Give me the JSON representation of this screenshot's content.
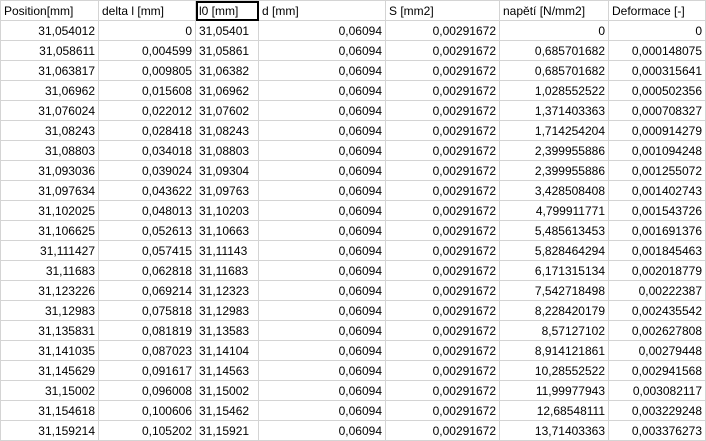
{
  "spreadsheet": {
    "headers": [
      "Position[mm]",
      "delta l [mm]",
      "l0 [mm]",
      "d [mm]",
      "S [mm2]",
      "napětí [N/mm2]",
      "Deformace [-]"
    ],
    "rows": [
      [
        "31,054012",
        "0",
        "31,05401",
        "0,06094",
        "0,00291672",
        "0",
        "0"
      ],
      [
        "31,058611",
        "0,004599",
        "31,05861",
        "0,06094",
        "0,00291672",
        "0,685701682",
        "0,000148075"
      ],
      [
        "31,063817",
        "0,009805",
        "31,06382",
        "0,06094",
        "0,00291672",
        "0,685701682",
        "0,000315641"
      ],
      [
        "31,06962",
        "0,015608",
        "31,06962",
        "0,06094",
        "0,00291672",
        "1,028552522",
        "0,000502356"
      ],
      [
        "31,076024",
        "0,022012",
        "31,07602",
        "0,06094",
        "0,00291672",
        "1,371403363",
        "0,000708327"
      ],
      [
        "31,08243",
        "0,028418",
        "31,08243",
        "0,06094",
        "0,00291672",
        "1,714254204",
        "0,000914279"
      ],
      [
        "31,08803",
        "0,034018",
        "31,08803",
        "0,06094",
        "0,00291672",
        "2,399955886",
        "0,001094248"
      ],
      [
        "31,093036",
        "0,039024",
        "31,09304",
        "0,06094",
        "0,00291672",
        "2,399955886",
        "0,001255072"
      ],
      [
        "31,097634",
        "0,043622",
        "31,09763",
        "0,06094",
        "0,00291672",
        "3,428508408",
        "0,001402743"
      ],
      [
        "31,102025",
        "0,048013",
        "31,10203",
        "0,06094",
        "0,00291672",
        "4,799911771",
        "0,001543726"
      ],
      [
        "31,106625",
        "0,052613",
        "31,10663",
        "0,06094",
        "0,00291672",
        "5,485613453",
        "0,001691376"
      ],
      [
        "31,111427",
        "0,057415",
        "31,11143",
        "0,06094",
        "0,00291672",
        "5,828464294",
        "0,001845463"
      ],
      [
        "31,11683",
        "0,062818",
        "31,11683",
        "0,06094",
        "0,00291672",
        "6,171315134",
        "0,002018779"
      ],
      [
        "31,123226",
        "0,069214",
        "31,12323",
        "0,06094",
        "0,00291672",
        "7,542718498",
        "0,00222387"
      ],
      [
        "31,12983",
        "0,075818",
        "31,12983",
        "0,06094",
        "0,00291672",
        "8,228420179",
        "0,002435542"
      ],
      [
        "31,135831",
        "0,081819",
        "31,13583",
        "0,06094",
        "0,00291672",
        "8,57127102",
        "0,002627808"
      ],
      [
        "31,141035",
        "0,087023",
        "31,14104",
        "0,06094",
        "0,00291672",
        "8,914121861",
        "0,00279448"
      ],
      [
        "31,145629",
        "0,091617",
        "31,14563",
        "0,06094",
        "0,00291672",
        "10,28552522",
        "0,002941568"
      ],
      [
        "31,15002",
        "0,096008",
        "31,15002",
        "0,06094",
        "0,00291672",
        "11,99977943",
        "0,003082117"
      ],
      [
        "31,154618",
        "0,100606",
        "31,15462",
        "0,06094",
        "0,00291672",
        "12,68548111",
        "0,003229248"
      ],
      [
        "31,159214",
        "0,105202",
        "31,15921",
        "0,06094",
        "0,00291672",
        "13,71403363",
        "0,003376273"
      ]
    ]
  }
}
